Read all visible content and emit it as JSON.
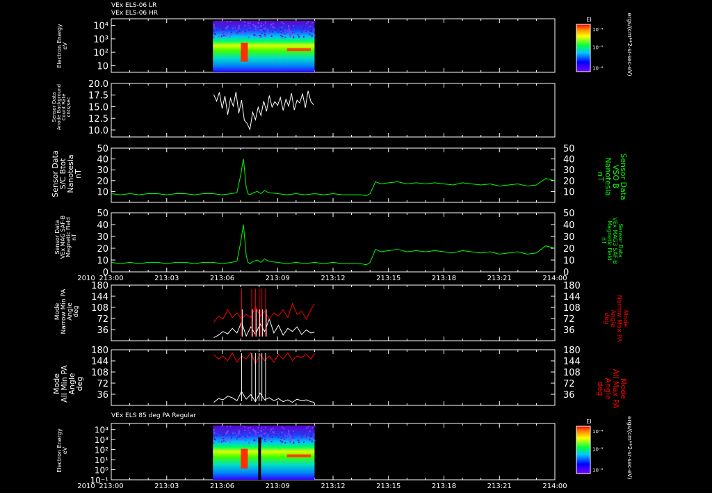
{
  "headers": {
    "h1": "VEx ELS-06 LR",
    "h2": "VEx ELS-06 HR",
    "h3": "VEx ELS 85 deg PA Regular"
  },
  "year_label": "2010",
  "colorbar": {
    "title": "EI",
    "ticks": [
      "10⁻⁴",
      "10⁻⁵",
      "10⁻⁶"
    ],
    "units": "ergs/(cm**2-sr-sec-eV)"
  },
  "x_axis": {
    "ticks": [
      "213:00",
      "213:03",
      "213:06",
      "213:09",
      "213:12",
      "213:15",
      "213:18",
      "213:21",
      "214:00"
    ]
  },
  "panel_labels": {
    "p1": [
      "Electron Energy",
      "eV"
    ],
    "p2": [
      "Sensor Data",
      "Anode Background",
      "Count Rate",
      "cnts/sec"
    ],
    "p3": [
      "Sensor Data",
      "S/C Btot",
      "Nanotesla",
      "nT"
    ],
    "p3r": [
      "Sensor Data",
      "VSO B",
      "Nanotesla",
      "nT"
    ],
    "p4": [
      "Sensor Data",
      "VEx MAG SAF-B",
      "Magnetic Field",
      "nT"
    ],
    "p4r": [
      "Sensor Data",
      "VEx MAG3 SAF-B",
      "Magnetic Field",
      "nT"
    ],
    "p5": [
      "Mode",
      "Narrow Min PA",
      "Angle",
      "deg"
    ],
    "p5r": [
      "Mode",
      "Narrow Max PA",
      "Angle",
      "deg"
    ],
    "p6": [
      "Mode",
      "All Min PA",
      "Angle",
      "deg"
    ],
    "p6r": [
      "Mode",
      "All Max PA",
      "Angle",
      "deg"
    ],
    "p7": [
      "Electron Energy",
      "eV"
    ]
  },
  "chart_data": [
    {
      "type": "heatmap",
      "title": "VEx ELS-06 LR / VEx ELS-06 HR",
      "ylabel": "Electron Energy eV",
      "y_scale": "log",
      "y_ticks": [
        "10",
        "10²",
        "10³",
        "10⁴"
      ],
      "data_span": [
        "213:05.5",
        "213:11.0"
      ]
    },
    {
      "type": "line",
      "ylabel": "Sensor Data Anode Background Count Rate cnts/sec",
      "ylim": [
        8.5,
        20.0
      ],
      "y_ticks": [
        "20.0",
        "17.5",
        "15.0",
        "12.5",
        "10.0"
      ],
      "x": [
        5.55,
        5.7,
        5.85,
        6.0,
        6.15,
        6.3,
        6.45,
        6.6,
        6.75,
        6.9,
        7.05,
        7.2,
        7.35,
        7.5,
        7.65,
        7.8,
        7.95,
        8.1,
        8.25,
        8.4,
        8.55,
        8.7,
        8.85,
        9.0,
        9.15,
        9.3,
        9.45,
        9.6,
        9.75,
        9.9,
        10.05,
        10.2,
        10.35,
        10.5,
        10.65,
        10.8,
        10.95
      ],
      "series": [
        {
          "color": "#ffffff",
          "values": [
            17.6,
            16.2,
            18.1,
            14.6,
            17.3,
            13.3,
            16.8,
            15.1,
            18.2,
            13.6,
            16.4,
            12.1,
            11.4,
            10.1,
            13.8,
            12.2,
            14.9,
            13.1,
            16.2,
            14.0,
            17.4,
            14.9,
            16.1,
            15.3,
            17.0,
            14.2,
            16.6,
            15.1,
            17.9,
            14.3,
            16.4,
            15.8,
            17.8,
            14.8,
            18.4,
            16.1,
            15.4
          ]
        }
      ]
    },
    {
      "type": "line",
      "ylabel": "Sensor Data S/C Btot Nanotesla nT",
      "ylim": [
        0,
        50
      ],
      "y_ticks": [
        "50",
        "40",
        "30",
        "20",
        "10"
      ],
      "x": [
        0,
        0.5,
        1,
        1.5,
        2,
        2.5,
        3,
        3.5,
        4,
        4.5,
        5,
        5.5,
        6,
        6.5,
        6.8,
        7.0,
        7.15,
        7.3,
        7.4,
        7.5,
        7.7,
        7.9,
        8.1,
        8.3,
        8.5,
        9,
        9.5,
        10,
        10.5,
        11,
        11.5,
        12,
        12.5,
        13,
        13.5,
        13.8,
        14.0,
        14.3,
        14.6,
        15,
        15.5,
        16,
        16.5,
        17,
        17.5,
        18,
        18.5,
        19,
        19.5,
        20,
        20.5,
        21,
        21.5,
        22,
        22.5,
        23,
        23.5,
        24
      ],
      "series": [
        {
          "color": "#00ff00",
          "values": [
            8,
            7,
            8,
            7,
            8,
            8,
            7,
            8,
            8,
            7,
            8,
            8,
            7,
            8,
            9,
            25,
            40,
            14,
            8,
            7,
            9,
            10,
            8,
            11,
            9,
            8,
            7,
            8,
            7,
            8,
            7,
            8,
            7,
            7,
            7,
            6,
            8,
            19,
            17,
            18,
            19,
            17,
            18,
            17,
            18,
            17,
            16,
            18,
            17,
            16,
            17,
            15,
            16,
            17,
            15,
            16,
            22,
            20
          ]
        }
      ]
    },
    {
      "type": "line",
      "ylabel": "Sensor Data VEx MAG SAF-B Magnetic Field nT",
      "ylim": [
        0,
        50
      ],
      "y_ticks": [
        "50",
        "40",
        "30",
        "20",
        "10",
        "0"
      ],
      "x": [
        0,
        0.5,
        1,
        1.5,
        2,
        2.5,
        3,
        3.5,
        4,
        4.5,
        5,
        5.5,
        6,
        6.5,
        6.8,
        7.0,
        7.15,
        7.3,
        7.4,
        7.5,
        7.7,
        7.9,
        8.1,
        8.3,
        8.5,
        9,
        9.5,
        10,
        10.5,
        11,
        11.5,
        12,
        12.5,
        13,
        13.5,
        13.8,
        14.0,
        14.3,
        14.6,
        15,
        15.5,
        16,
        16.5,
        17,
        17.5,
        18,
        18.5,
        19,
        19.5,
        20,
        20.5,
        21,
        21.5,
        22,
        22.5,
        23,
        23.5,
        24
      ],
      "series": [
        {
          "color": "#00ff00",
          "values": [
            8,
            7,
            8,
            7,
            8,
            8,
            7,
            8,
            8,
            7,
            8,
            8,
            7,
            8,
            9,
            25,
            40,
            14,
            8,
            7,
            9,
            10,
            8,
            11,
            9,
            8,
            7,
            8,
            7,
            8,
            7,
            8,
            7,
            7,
            7,
            6,
            8,
            19,
            17,
            18,
            19,
            17,
            18,
            17,
            18,
            17,
            16,
            18,
            17,
            16,
            17,
            15,
            16,
            17,
            15,
            16,
            22,
            20
          ]
        }
      ]
    },
    {
      "type": "line",
      "ylabel": "Mode Narrow Min PA Angle deg",
      "ylim": [
        0,
        180
      ],
      "y_ticks": [
        "180",
        "144",
        "108",
        "72",
        "36"
      ],
      "x": [
        5.55,
        5.8,
        6.05,
        6.3,
        6.55,
        6.8,
        7.05,
        7.3,
        7.55,
        7.8,
        8.05,
        8.3,
        8.55,
        8.8,
        9.05,
        9.3,
        9.55,
        9.8,
        10.05,
        10.3,
        10.55,
        10.8,
        11.0
      ],
      "series": [
        {
          "color": "#ffffff",
          "values": [
            10,
            18,
            30,
            22,
            40,
            25,
            60,
            15,
            45,
            20,
            55,
            30,
            70,
            25,
            50,
            18,
            40,
            30,
            45,
            20,
            35,
            25,
            28
          ]
        },
        {
          "color": "#ff0000",
          "values": [
            60,
            80,
            70,
            100,
            75,
            90,
            70,
            85,
            75,
            110,
            80,
            95,
            70,
            90,
            80,
            100,
            75,
            120,
            85,
            95,
            70,
            100,
            120
          ]
        }
      ]
    },
    {
      "type": "line",
      "ylabel": "Mode All Min PA Angle deg",
      "ylim": [
        0,
        180
      ],
      "y_ticks": [
        "180",
        "144",
        "108",
        "72",
        "36"
      ],
      "x": [
        5.55,
        5.8,
        6.05,
        6.3,
        6.55,
        6.8,
        7.05,
        7.3,
        7.55,
        7.8,
        8.05,
        8.3,
        8.55,
        8.8,
        9.05,
        9.3,
        9.55,
        9.8,
        10.05,
        10.3,
        10.55,
        10.8,
        11.0
      ],
      "series": [
        {
          "color": "#ffffff",
          "values": [
            10,
            22,
            18,
            30,
            25,
            15,
            45,
            20,
            35,
            12,
            40,
            18,
            25,
            15,
            22,
            12,
            18,
            10,
            20,
            15,
            18,
            12,
            10
          ]
        },
        {
          "color": "#ff0000",
          "values": [
            165,
            150,
            160,
            145,
            170,
            140,
            160,
            150,
            170,
            135,
            165,
            145,
            160,
            140,
            165,
            150,
            170,
            145,
            160,
            155,
            165,
            150,
            168
          ]
        }
      ]
    },
    {
      "type": "heatmap",
      "title": "VEx ELS 85 deg PA Regular",
      "ylabel": "Electron Energy eV",
      "y_scale": "log",
      "y_ticks": [
        "10⁻¹",
        "10⁰",
        "10¹",
        "10²",
        "10³",
        "10⁴"
      ],
      "data_span": [
        "213:05.5",
        "213:11.0"
      ]
    }
  ]
}
